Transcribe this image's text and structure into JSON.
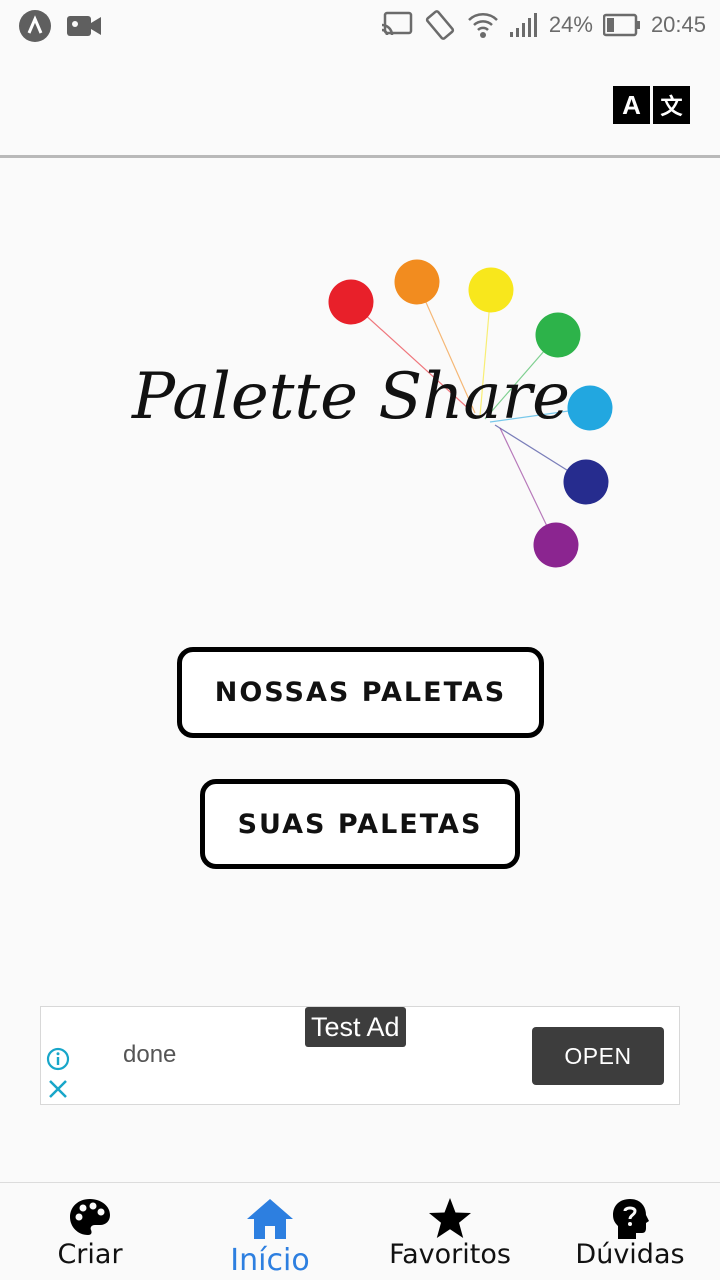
{
  "status_bar": {
    "battery": "24%",
    "time": "20:45",
    "icons": [
      "app-logo-icon",
      "video-camera-icon",
      "cast-icon",
      "rotate-icon",
      "wifi-icon",
      "signal-icon",
      "battery-icon"
    ]
  },
  "app_bar": {
    "translate_icon_left": "A",
    "translate_icon_right": "文"
  },
  "logo": {
    "text": "Palette Share",
    "dot_colors": [
      "#e8202a",
      "#f28c1f",
      "#f8e71c",
      "#2db34a",
      "#22a7e0",
      "#262c8e",
      "#8b2590"
    ]
  },
  "buttons": {
    "nossas": "NOSSAS PALETAS",
    "suas": "SUAS PALETAS"
  },
  "ad": {
    "badge": "Test Ad",
    "text": "done",
    "open_label": "OPEN"
  },
  "bottom_nav": {
    "items": [
      {
        "label": "Criar",
        "icon": "palette-icon"
      },
      {
        "label": "Início",
        "icon": "home-icon"
      },
      {
        "label": "Favoritos",
        "icon": "star-icon"
      },
      {
        "label": "Dúvidas",
        "icon": "question-head-icon"
      }
    ],
    "active_index": 1,
    "active_color": "#2d7fe0"
  }
}
